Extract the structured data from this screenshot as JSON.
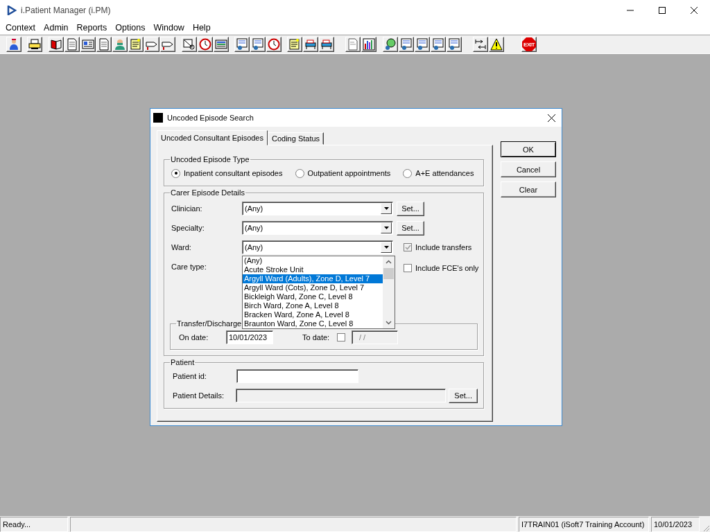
{
  "window": {
    "title": "i.Patient Manager (i.PM)"
  },
  "menu": [
    "Context",
    "Admin",
    "Reports",
    "Options",
    "Window",
    "Help"
  ],
  "toolbar": {
    "exit_label": "EXIT"
  },
  "dialog": {
    "title": "Uncoded Episode Search",
    "tabs": [
      {
        "label": "Uncoded Consultant Episodes",
        "selected": true
      },
      {
        "label": "Coding Status",
        "selected": false
      }
    ],
    "episode_type": {
      "legend": "Uncoded Episode Type",
      "options": [
        {
          "label": "Inpatient consultant episodes",
          "selected": true
        },
        {
          "label": "Outpatient appointments",
          "selected": false
        },
        {
          "label": "A+E attendances",
          "selected": false
        }
      ]
    },
    "carer": {
      "legend": "Carer Episode Details",
      "fields": [
        {
          "label": "Clinician:",
          "value": "(Any)",
          "set_button": "Set..."
        },
        {
          "label": "Specialty:",
          "value": "(Any)",
          "set_button": "Set..."
        },
        {
          "label": "Ward:",
          "value": "(Any)"
        },
        {
          "label": "Care type:"
        }
      ],
      "checkboxes": [
        {
          "label": "Include transfers",
          "checked": true,
          "disabled": true
        },
        {
          "label": "Include FCE's only",
          "checked": false,
          "disabled": false
        }
      ],
      "transfer": {
        "legend": "Transfer/Discharge",
        "on_date_label": "On date:",
        "on_date": "10/01/2023",
        "to_date_label": "To date:",
        "to_date_checked": false,
        "to_date": "/ /"
      }
    },
    "ward_dropdown": {
      "items": [
        {
          "label": "(Any)",
          "selected": false
        },
        {
          "label": "Acute Stroke Unit",
          "selected": false
        },
        {
          "label": "Argyll Ward (Adults), Zone D, Level 7",
          "selected": true
        },
        {
          "label": "Argyll Ward (Cots), Zone D, Level 7",
          "selected": false
        },
        {
          "label": "Bickleigh Ward, Zone C, Level 8",
          "selected": false
        },
        {
          "label": "Birch Ward, Zone A, Level 8",
          "selected": false
        },
        {
          "label": "Bracken Ward, Zone A, Level 8",
          "selected": false
        },
        {
          "label": "Braunton Ward, Zone C, Level 8",
          "selected": false
        }
      ]
    },
    "patient": {
      "legend": "Patient",
      "id_label": "Patient id:",
      "details_label": "Patient Details:",
      "set_button": "Set..."
    },
    "buttons": [
      "OK",
      "Cancel",
      "Clear"
    ]
  },
  "status_bar": {
    "message": "Ready...",
    "account": "I7TRAIN01 (iSoft7 Training Account)",
    "date": "10/01/2023"
  }
}
